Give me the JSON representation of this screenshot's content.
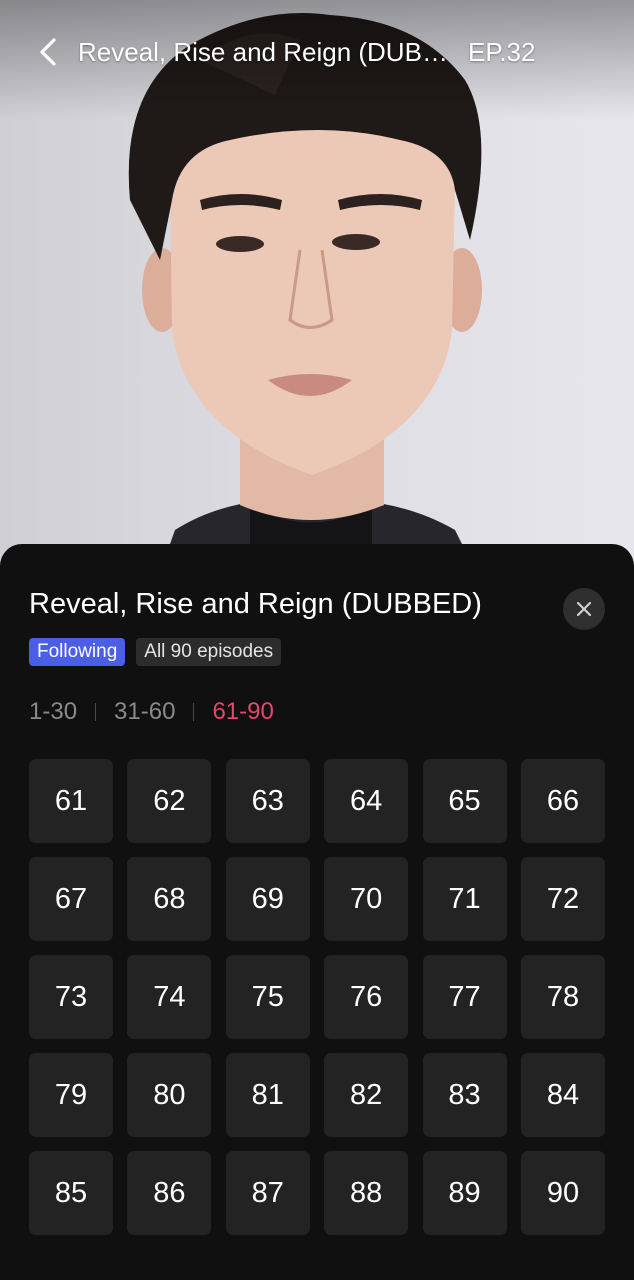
{
  "header": {
    "title": "Reveal, Rise and Reign (DUBBED)",
    "episode_label": "EP.32"
  },
  "icons": {
    "back": "chevron-left-icon",
    "close": "close-icon"
  },
  "sheet": {
    "title": "Reveal, Rise and Reign (DUBBED)",
    "badges": {
      "following": "Following",
      "all_episodes": "All 90 episodes"
    },
    "ranges": [
      "1-30",
      "31-60",
      "61-90"
    ],
    "active_range": "61-90",
    "episodes": [
      "61",
      "62",
      "63",
      "64",
      "65",
      "66",
      "67",
      "68",
      "69",
      "70",
      "71",
      "72",
      "73",
      "74",
      "75",
      "76",
      "77",
      "78",
      "79",
      "80",
      "81",
      "82",
      "83",
      "84",
      "85",
      "86",
      "87",
      "88",
      "89",
      "90"
    ]
  },
  "colors": {
    "accent_active_range": "#e8456b",
    "following_badge": "#4a5fe6",
    "sheet_background": "#101010",
    "episode_cell": "#232323"
  }
}
